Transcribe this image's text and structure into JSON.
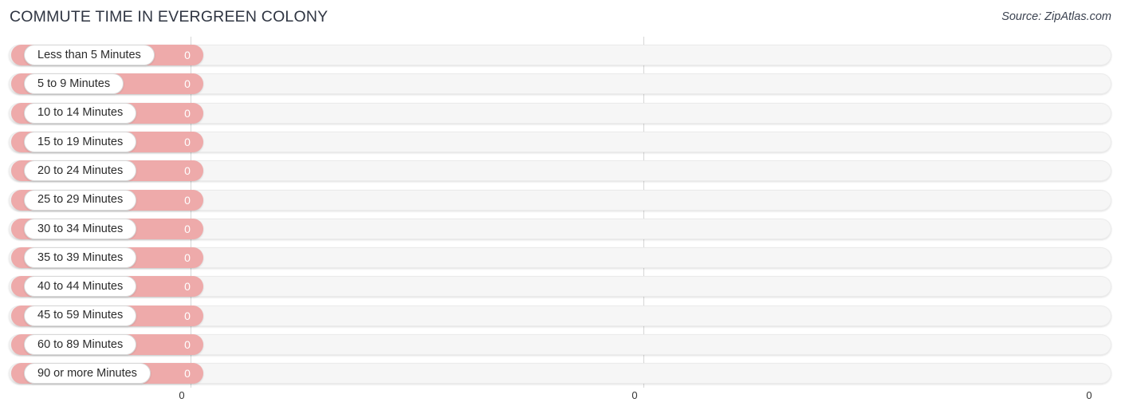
{
  "header": {
    "title": "COMMUTE TIME IN EVERGREEN COLONY",
    "source": "Source: ZipAtlas.com"
  },
  "chart_data": {
    "type": "bar",
    "orientation": "horizontal",
    "title": "COMMUTE TIME IN EVERGREEN COLONY",
    "subtitle": "",
    "xlabel": "",
    "ylabel": "",
    "grid": true,
    "legend": null,
    "xlim": [
      0,
      0
    ],
    "axis_ticks": [
      "0",
      "0",
      "0"
    ],
    "bar_color": "#eeaaaa",
    "track_color": "#f6f6f6",
    "categories": [
      "Less than 5 Minutes",
      "5 to 9 Minutes",
      "10 to 14 Minutes",
      "15 to 19 Minutes",
      "20 to 24 Minutes",
      "25 to 29 Minutes",
      "30 to 34 Minutes",
      "35 to 39 Minutes",
      "40 to 44 Minutes",
      "45 to 59 Minutes",
      "60 to 89 Minutes",
      "90 or more Minutes"
    ],
    "values": [
      0,
      0,
      0,
      0,
      0,
      0,
      0,
      0,
      0,
      0,
      0,
      0
    ],
    "value_labels": [
      "0",
      "0",
      "0",
      "0",
      "0",
      "0",
      "0",
      "0",
      "0",
      "0",
      "0",
      "0"
    ]
  }
}
